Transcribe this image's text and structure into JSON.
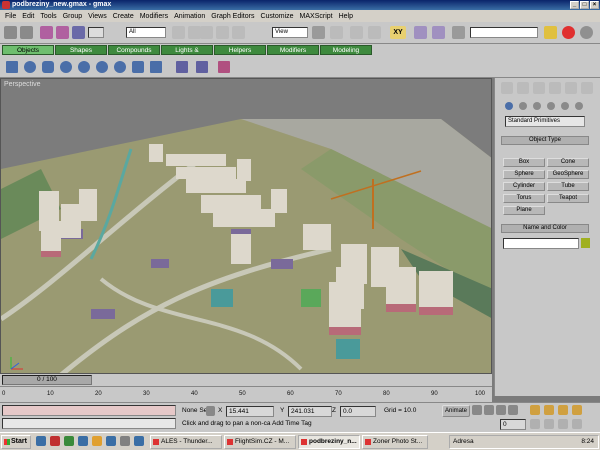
{
  "window": {
    "title": "podbreziny_new.gmax - gmax",
    "min": "_",
    "max": "□",
    "close": "×"
  },
  "menu": [
    "File",
    "Edit",
    "Tools",
    "Group",
    "Views",
    "Create",
    "Modifiers",
    "Animation",
    "Graph Editors",
    "Customize",
    "MAXScript",
    "Help"
  ],
  "toolbar": {
    "selection_filter": "All",
    "ref_coord": "View",
    "axis_constraint": "XY"
  },
  "tabs": [
    "Objects",
    "Shapes",
    "Compounds",
    "Lights & Cameras",
    "Helpers",
    "Modifiers",
    "Modeling"
  ],
  "viewport": {
    "label": "Perspective"
  },
  "command_panel": {
    "category": "Standard Primitives",
    "object_type_title": "Object Type",
    "primitives": [
      "Box",
      "Cone",
      "Sphere",
      "GeoSphere",
      "Cylinder",
      "Tube",
      "Torus",
      "Teapot",
      "Plane"
    ],
    "name_color_title": "Name and Color"
  },
  "timeline": {
    "slider": "0 / 100",
    "ticks": [
      "0",
      "10",
      "20",
      "30",
      "40",
      "50",
      "60",
      "70",
      "80",
      "90",
      "100"
    ]
  },
  "status": {
    "selection": "None Sel",
    "x_label": "X",
    "x_value": "15.441",
    "y_label": "Y",
    "y_value": "241.031",
    "z_label": "Z",
    "z_value": "0.0",
    "grid": "Grid = 10.0",
    "animate": "Animate",
    "prompt": "Click and drag to pan a non-ca",
    "time_tag": "Add Time Tag",
    "frame": "0"
  },
  "taskbar": {
    "start": "Start",
    "tasks": [
      "ALES - Thunder...",
      "FlightSim.CZ - M...",
      "podbreziny_n...",
      "Zoner Photo St..."
    ],
    "language": "Adresa",
    "clock": "8:24"
  },
  "colors": {
    "tab_green": "#3e8a3e",
    "active_tab": "#6ebe6e",
    "title_blue": "#0a246a",
    "ground": "#9a9a72",
    "building_wall": "#ddd8cc",
    "building_base": "#b86a78"
  }
}
